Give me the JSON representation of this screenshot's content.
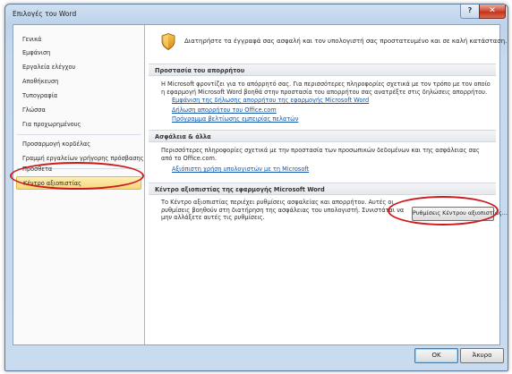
{
  "window": {
    "title": "Επιλογές του Word",
    "help_label": "?",
    "close_label": "✕"
  },
  "sidebar": {
    "items": [
      {
        "label": "Γενικά"
      },
      {
        "label": "Εμφάνιση"
      },
      {
        "label": "Εργαλεία ελέγχου"
      },
      {
        "label": "Αποθήκευση"
      },
      {
        "label": "Τυπογραφία"
      },
      {
        "label": "Γλώσσα"
      },
      {
        "label": "Για προχωρημένους"
      },
      {
        "label": "Προσαρμογή κορδέλας"
      },
      {
        "label": "Γραμμή εργαλείων γρήγορης πρόσβασης"
      },
      {
        "label": "Πρόσθετα"
      },
      {
        "label": "Κέντρο αξιοπιστίας"
      }
    ],
    "selected_index": 10
  },
  "header": {
    "icon": "shield-icon",
    "text": "Διατηρήστε τα έγγραφά σας ασφαλή και τον υπολογιστή σας προστατευμένο και σε καλή κατάσταση."
  },
  "privacy": {
    "heading": "Προστασία του απορρήτου",
    "text": "Η Microsoft φροντίζει για το απόρρητό σας. Για περισσότερες πληροφορίες σχετικά με τον τρόπο με τον οποίο η εφαρμογή Microsoft Word βοηθά στην προστασία του απορρήτου σας ανατρέξτε στις δηλώσεις απορρήτου.",
    "links": [
      "Εμφάνιση της δήλωσης απορρήτου της εφαρμογής Microsoft Word",
      "Δήλωση απορρήτου του Office.com",
      "Πρόγραμμα βελτίωσης εμπειρίας πελατών"
    ]
  },
  "security": {
    "heading": "Ασφάλεια & άλλα",
    "text": "Περισσότερες πληροφορίες σχετικά με την προστασία των προσωπικών δεδομένων και της ασφάλειας σας από το Office.com.",
    "link": "Αξιόπιστη χρήση υπολογιστών με τη Microsoft"
  },
  "trust_center": {
    "heading": "Κέντρο αξιοπιστίας της εφαρμογής Microsoft Word",
    "text": "Το Κέντρο αξιοπιστίας περιέχει ρυθμίσεις ασφαλείας και απορρήτου. Αυτές οι ρυθμίσεις βοηθούν στη διατήρηση της ασφάλειας του υπολογιστή. Συνιστάται να μην αλλάξετε αυτές τις ρυθμίσεις.",
    "button_label": "Ρυθμίσεις Κέντρου αξιοπιστίας..."
  },
  "footer": {
    "ok_label": "OK",
    "cancel_label": "Άκυρο"
  },
  "colors": {
    "annotation": "#cc1b1b",
    "selected_bg": "#f7d778",
    "link": "#1155aa"
  }
}
